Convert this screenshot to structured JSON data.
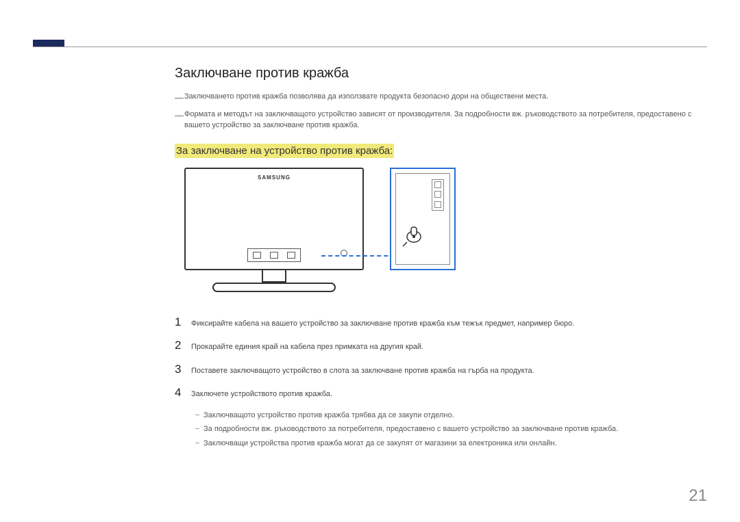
{
  "page_number": "21",
  "section": {
    "title": "Заключване против кражба",
    "notes": [
      "Заключването против кражба позволява да използвате продукта безопасно дори на обществени места.",
      "Формата и методът на заключващото устройство зависят от производителя. За подробности вж. ръководството за потребителя, предоставено с вашето устройство за заключване против кражба."
    ],
    "sub_title": "За заключване на устройство против кражба:"
  },
  "figure": {
    "brand": "SAMSUNG",
    "monitor_back_alt": "monitor-rear-view",
    "lock_detail_alt": "lock-slot-detail"
  },
  "steps": [
    {
      "num": "1",
      "text": "Фиксирайте кабела на вашето устройство за заключване против кражба към тежък предмет, например бюро."
    },
    {
      "num": "2",
      "text": "Прокарайте единия край на кабела през примката на другия край."
    },
    {
      "num": "3",
      "text": "Поставете заключващото устройство в слота за заключване против кражба на гърба на продукта."
    },
    {
      "num": "4",
      "text": "Заключете устройството против кражба."
    }
  ],
  "sub_notes": [
    "Заключващото устройство против кражба трябва да се закупи отделно.",
    "За подробности вж. ръководството за потребителя, предоставено с вашето устройство за заключване против кражба.",
    "Заключващи устройства против кражба могат да се закупят от магазини за електроника или онлайн."
  ]
}
